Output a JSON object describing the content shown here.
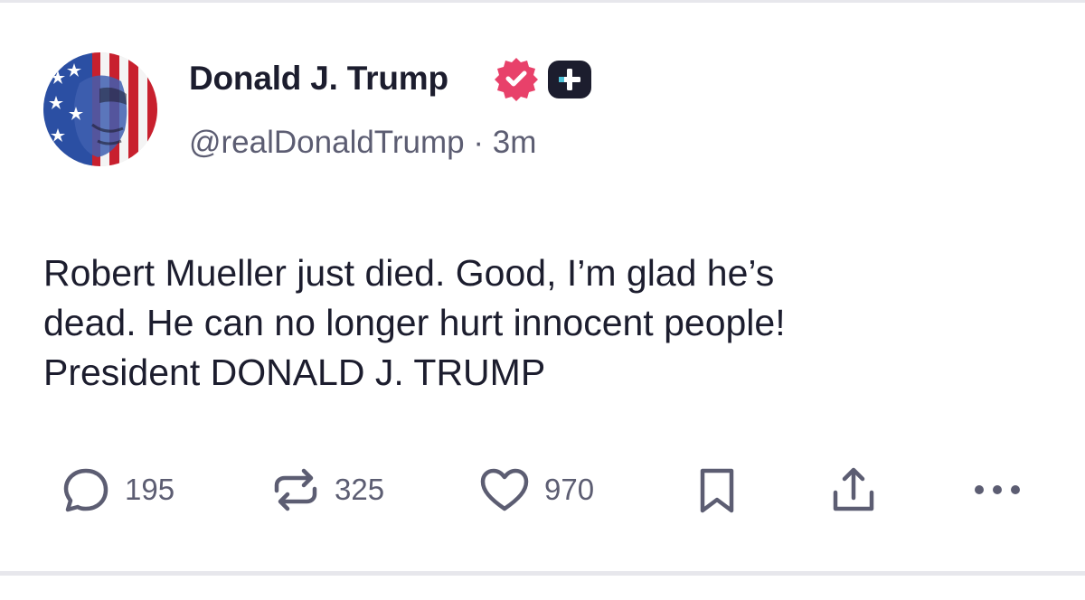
{
  "post": {
    "author": {
      "display_name": "Donald J. Trump",
      "handle": "@realDonaldTrump",
      "separator": "·",
      "time_ago": "3m",
      "avatar_icon": "avatar-flag-portrait",
      "verified_icon": "verified-badge-icon",
      "verified_color": "#e8416a",
      "subscriber_icon": "plus-badge-icon"
    },
    "body_lines": [
      "Robert Mueller just died. Good, I’m glad he’s",
      "dead. He can no longer hurt innocent people!",
      "President DONALD J. TRUMP"
    ],
    "actions": {
      "replies": {
        "icon": "reply-icon",
        "count": "195"
      },
      "reposts": {
        "icon": "repost-icon",
        "count": "325"
      },
      "likes": {
        "icon": "heart-icon",
        "count": "970"
      },
      "bookmark": {
        "icon": "bookmark-icon"
      },
      "share": {
        "icon": "share-icon"
      },
      "more": {
        "icon": "more-icon"
      }
    }
  },
  "colors": {
    "text": "#1c1d2e",
    "muted": "#5c5d72",
    "divider": "#e7e7ec",
    "background": "#ffffff"
  }
}
